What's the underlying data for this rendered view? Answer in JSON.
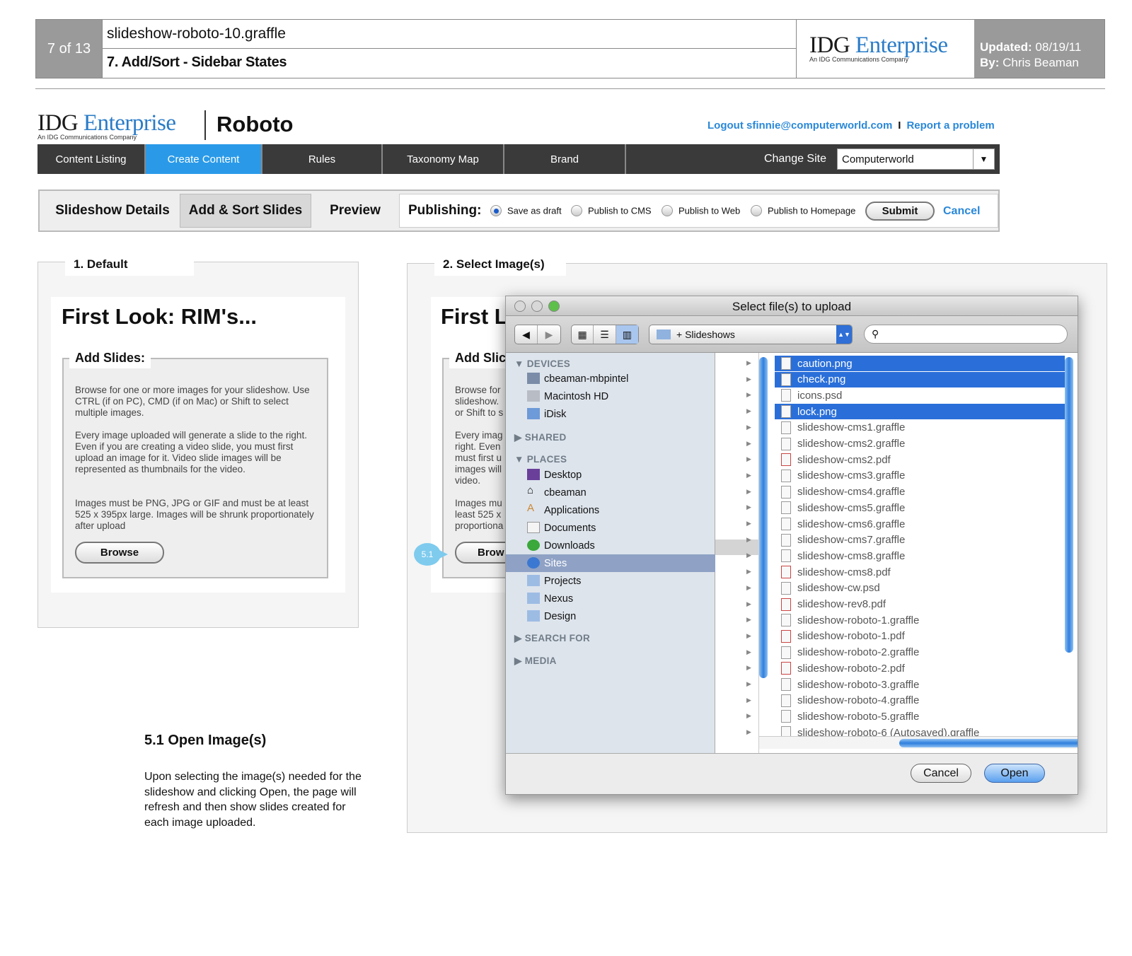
{
  "header": {
    "page_counter": "7 of 13",
    "file_name": "slideshow-roboto-10.graffle",
    "section_title": "7. Add/Sort - Sidebar States",
    "logo_primary": "IDG",
    "logo_secondary": "Enterprise",
    "logo_tagline": "An IDG Communications Company",
    "updated_label": "Updated:",
    "updated_value": "08/19/11",
    "by_label": "By:",
    "by_value": "Chris Beaman"
  },
  "app": {
    "logo_primary": "IDG",
    "logo_secondary": "Enterprise",
    "logo_tagline": "An IDG Communications Company",
    "name": "Roboto",
    "logout_text": "Logout sfinnie@computerworld.com",
    "separator": "I",
    "report_text": "Report a problem"
  },
  "nav": {
    "tabs": [
      "Content Listing",
      "Create Content",
      "Rules",
      "Taxonomy Map",
      "Brand"
    ],
    "active_tab": "Create Content",
    "change_site_label": "Change Site",
    "site_value": "Computerworld"
  },
  "subnav": {
    "tabs": [
      "Slideshow Details",
      "Add & Sort Slides",
      "Preview"
    ],
    "active_tab": "Add & Sort Slides",
    "publishing_label": "Publishing:",
    "options": [
      "Save as draft",
      "Publish to CMS",
      "Publish to Web",
      "Publish to Homepage"
    ],
    "selected_option": "Save as draft",
    "submit_label": "Submit",
    "cancel_label": "Cancel"
  },
  "panel1": {
    "legend": "1. Default",
    "heading": "First Look: RIM's...",
    "add_title": "Add Slides:",
    "para1": "Browse for one or more images for your slideshow. Use CTRL (if on PC), CMD (if on Mac) or Shift to select multiple images.",
    "para2": "Every image uploaded will generate a slide to the right. Even if you are creating a video slide, you must first upload an image for it. Video slide images will be represented as thumbnails for the video.",
    "para3": "Images must be PNG, JPG or GIF and must be at least 525 x 395px large. Images will be shrunk proportionately after upload",
    "browse_label": "Browse"
  },
  "panel2": {
    "legend": "2. Select Image(s)",
    "heading": "First L",
    "add_title": "Add Slic",
    "para1": "Browse for\nslideshow.\nor Shift to s",
    "para2": "Every imag\nright. Even\nmust first u\nimages will\nvideo.",
    "para3": "Images mu\nleast 525 x\nproportiona",
    "browse_label": "Brow",
    "callout": "5.1"
  },
  "dialog": {
    "title": "Select file(s) to upload",
    "location": "+ Slideshows",
    "sidebar": {
      "devices_label": "DEVICES",
      "devices": [
        "cbeaman-mbpintel",
        "Macintosh HD",
        "iDisk"
      ],
      "shared_label": "SHARED",
      "places_label": "PLACES",
      "places": [
        "Desktop",
        "cbeaman",
        "Applications",
        "Documents",
        "Downloads",
        "Sites",
        "Projects",
        "Nexus",
        "Design"
      ],
      "selected_place": "Sites",
      "search_label": "SEARCH FOR",
      "media_label": "MEDIA"
    },
    "files": [
      {
        "name": "caution.png",
        "selected": true
      },
      {
        "name": "check.png",
        "selected": true
      },
      {
        "name": "icons.psd",
        "selected": false
      },
      {
        "name": "lock.png",
        "selected": true
      },
      {
        "name": "slideshow-cms1.graffle",
        "selected": false
      },
      {
        "name": "slideshow-cms2.graffle",
        "selected": false
      },
      {
        "name": "slideshow-cms2.pdf",
        "selected": false
      },
      {
        "name": "slideshow-cms3.graffle",
        "selected": false
      },
      {
        "name": "slideshow-cms4.graffle",
        "selected": false
      },
      {
        "name": "slideshow-cms5.graffle",
        "selected": false
      },
      {
        "name": "slideshow-cms6.graffle",
        "selected": false
      },
      {
        "name": "slideshow-cms7.graffle",
        "selected": false
      },
      {
        "name": "slideshow-cms8.graffle",
        "selected": false
      },
      {
        "name": "slideshow-cms8.pdf",
        "selected": false
      },
      {
        "name": "slideshow-cw.psd",
        "selected": false
      },
      {
        "name": "slideshow-rev8.pdf",
        "selected": false
      },
      {
        "name": "slideshow-roboto-1.graffle",
        "selected": false
      },
      {
        "name": "slideshow-roboto-1.pdf",
        "selected": false
      },
      {
        "name": "slideshow-roboto-2.graffle",
        "selected": false
      },
      {
        "name": "slideshow-roboto-2.pdf",
        "selected": false
      },
      {
        "name": "slideshow-roboto-3.graffle",
        "selected": false
      },
      {
        "name": "slideshow-roboto-4.graffle",
        "selected": false
      },
      {
        "name": "slideshow-roboto-5.graffle",
        "selected": false
      },
      {
        "name": "slideshow-roboto-6 (Autosaved).graffle",
        "selected": false
      }
    ],
    "cancel_label": "Cancel",
    "open_label": "Open"
  },
  "note": {
    "title": "5.1 Open Image(s)",
    "body": "Upon selecting the image(s) needed for the slideshow and clicking Open, the page will refresh and then show slides created for each image uploaded."
  },
  "colors": {
    "accent": "#2a9ae8",
    "link": "#2a88d8",
    "nav_bg": "#3a3a3a",
    "header_gray": "#9a9a9a",
    "selection": "#2a6fd9"
  }
}
